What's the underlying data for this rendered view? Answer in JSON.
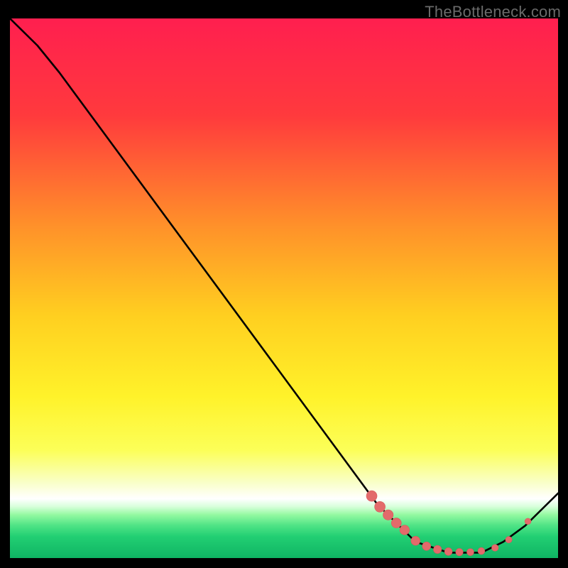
{
  "watermark": "TheBottleneck.com",
  "colors": {
    "bg": "#000000",
    "curve": "#000000",
    "marker_fill": "#e36a6b",
    "marker_stroke": "#d85a5c",
    "gradient_top": "#ff1f4f",
    "gradient_upper_mid": "#ff7a2a",
    "gradient_mid": "#ffd21f",
    "gradient_low": "#f4ff3a",
    "gradient_pale": "#fbffe0",
    "gradient_green1": "#8dff88",
    "gradient_green2": "#35e07a",
    "gradient_green3": "#12c06a"
  },
  "chart_data": {
    "type": "line",
    "title": "",
    "xlabel": "",
    "ylabel": "",
    "xlim": [
      0,
      100
    ],
    "ylim": [
      0,
      100
    ],
    "series": [
      {
        "name": "curve",
        "x": [
          0,
          5,
          9,
          67,
          74,
          80,
          86,
          90,
          94,
          100
        ],
        "y": [
          100,
          95,
          90,
          10,
          3,
          1,
          1,
          3,
          6,
          12
        ]
      }
    ],
    "markers": {
      "name": "highlighted-points",
      "color": "#e36a6b",
      "x": [
        66,
        67.5,
        69,
        70.5,
        72,
        74,
        76,
        78,
        80,
        82,
        84,
        86,
        88.5,
        91,
        94.5
      ],
      "y": [
        11.5,
        9.5,
        8,
        6.5,
        5.2,
        3.2,
        2.2,
        1.6,
        1.2,
        1.1,
        1.1,
        1.3,
        1.9,
        3.4,
        6.8
      ],
      "r": [
        7.5,
        7.5,
        7.2,
        7.0,
        6.8,
        6.4,
        6.0,
        5.7,
        5.4,
        5.2,
        5.0,
        4.9,
        4.8,
        4.6,
        4.4
      ]
    }
  }
}
